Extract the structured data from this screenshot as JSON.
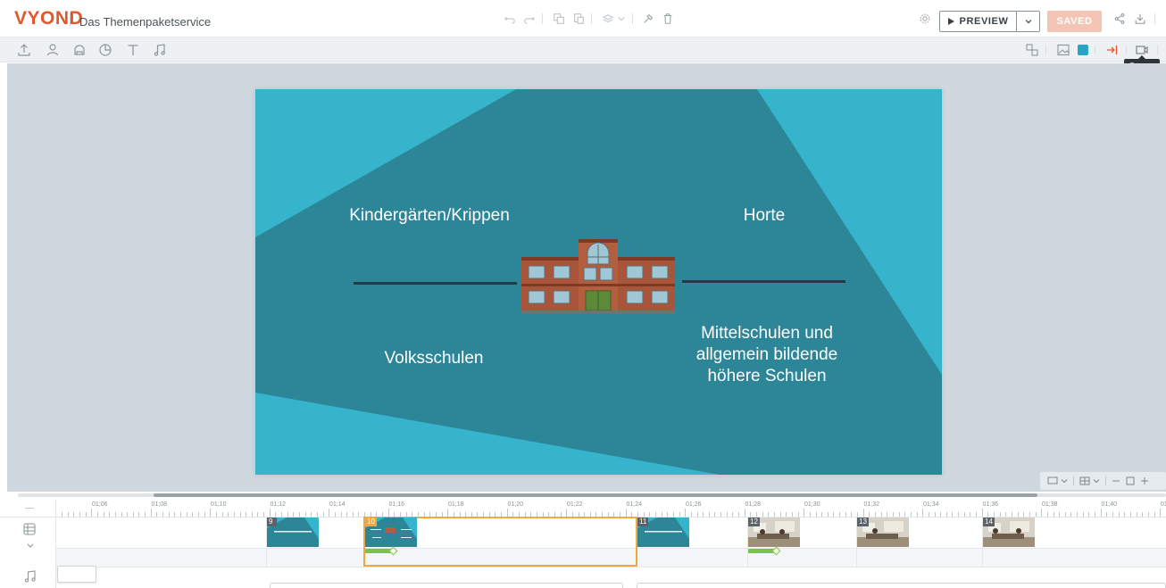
{
  "app": {
    "logo_text": "VYOND",
    "project_title": "Das Themenpaketservice"
  },
  "header": {
    "preview_label": "PREVIEW",
    "saved_label": "SAVED"
  },
  "toolbar2": {
    "tooltip": "Camera",
    "color_swatch": "#2aa3c4"
  },
  "slide": {
    "texts": {
      "kita": "Kindergärten/Krippen",
      "horte": "Horte",
      "volks": "Volksschulen",
      "mittel_1": "Mittelschulen und",
      "mittel_2": "allgemein bildende",
      "mittel_3": "höhere Schulen"
    },
    "colors": {
      "bg_dark": "#2d8598",
      "bg_light": "#35b4cc",
      "line": "#1e3d48"
    }
  },
  "timeline": {
    "ruler_labels": [
      "01;06",
      "01;08",
      "01;10",
      "01;12",
      "01;14",
      "01;16",
      "01;18",
      "01;20",
      "01;22",
      "01;24",
      "01;26",
      "01;28",
      "01;30",
      "01;32",
      "01;34",
      "01;36",
      "01;38",
      "01;40",
      "01;"
    ],
    "scenes": [
      {
        "number": "9"
      },
      {
        "number": "10"
      },
      {
        "number": "11"
      },
      {
        "number": "12"
      },
      {
        "number": "13"
      },
      {
        "number": "14"
      }
    ],
    "accent_selected": "#f0a83a",
    "accent_transition": "#7cc24a"
  }
}
